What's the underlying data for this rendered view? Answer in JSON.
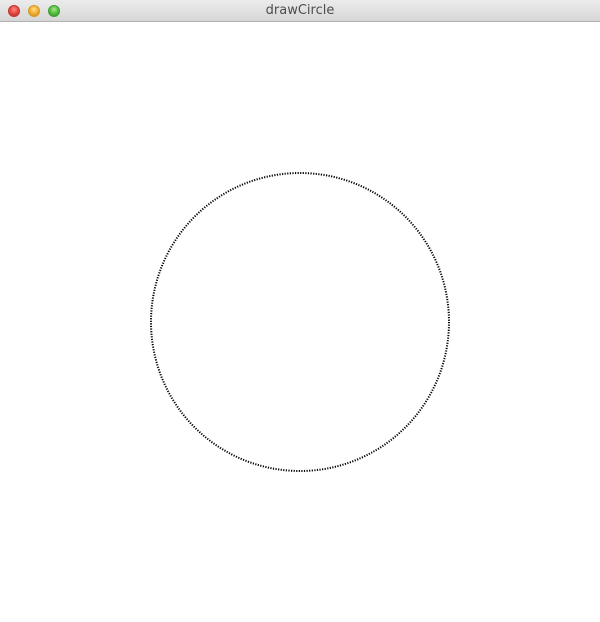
{
  "window": {
    "title": "drawCircle",
    "controls": {
      "close": "close-button",
      "minimize": "minimize-button",
      "zoom": "zoom-button"
    }
  },
  "canvas": {
    "background": "#ffffff",
    "stroke_color": "#000000",
    "shape": "dotted-circle"
  }
}
